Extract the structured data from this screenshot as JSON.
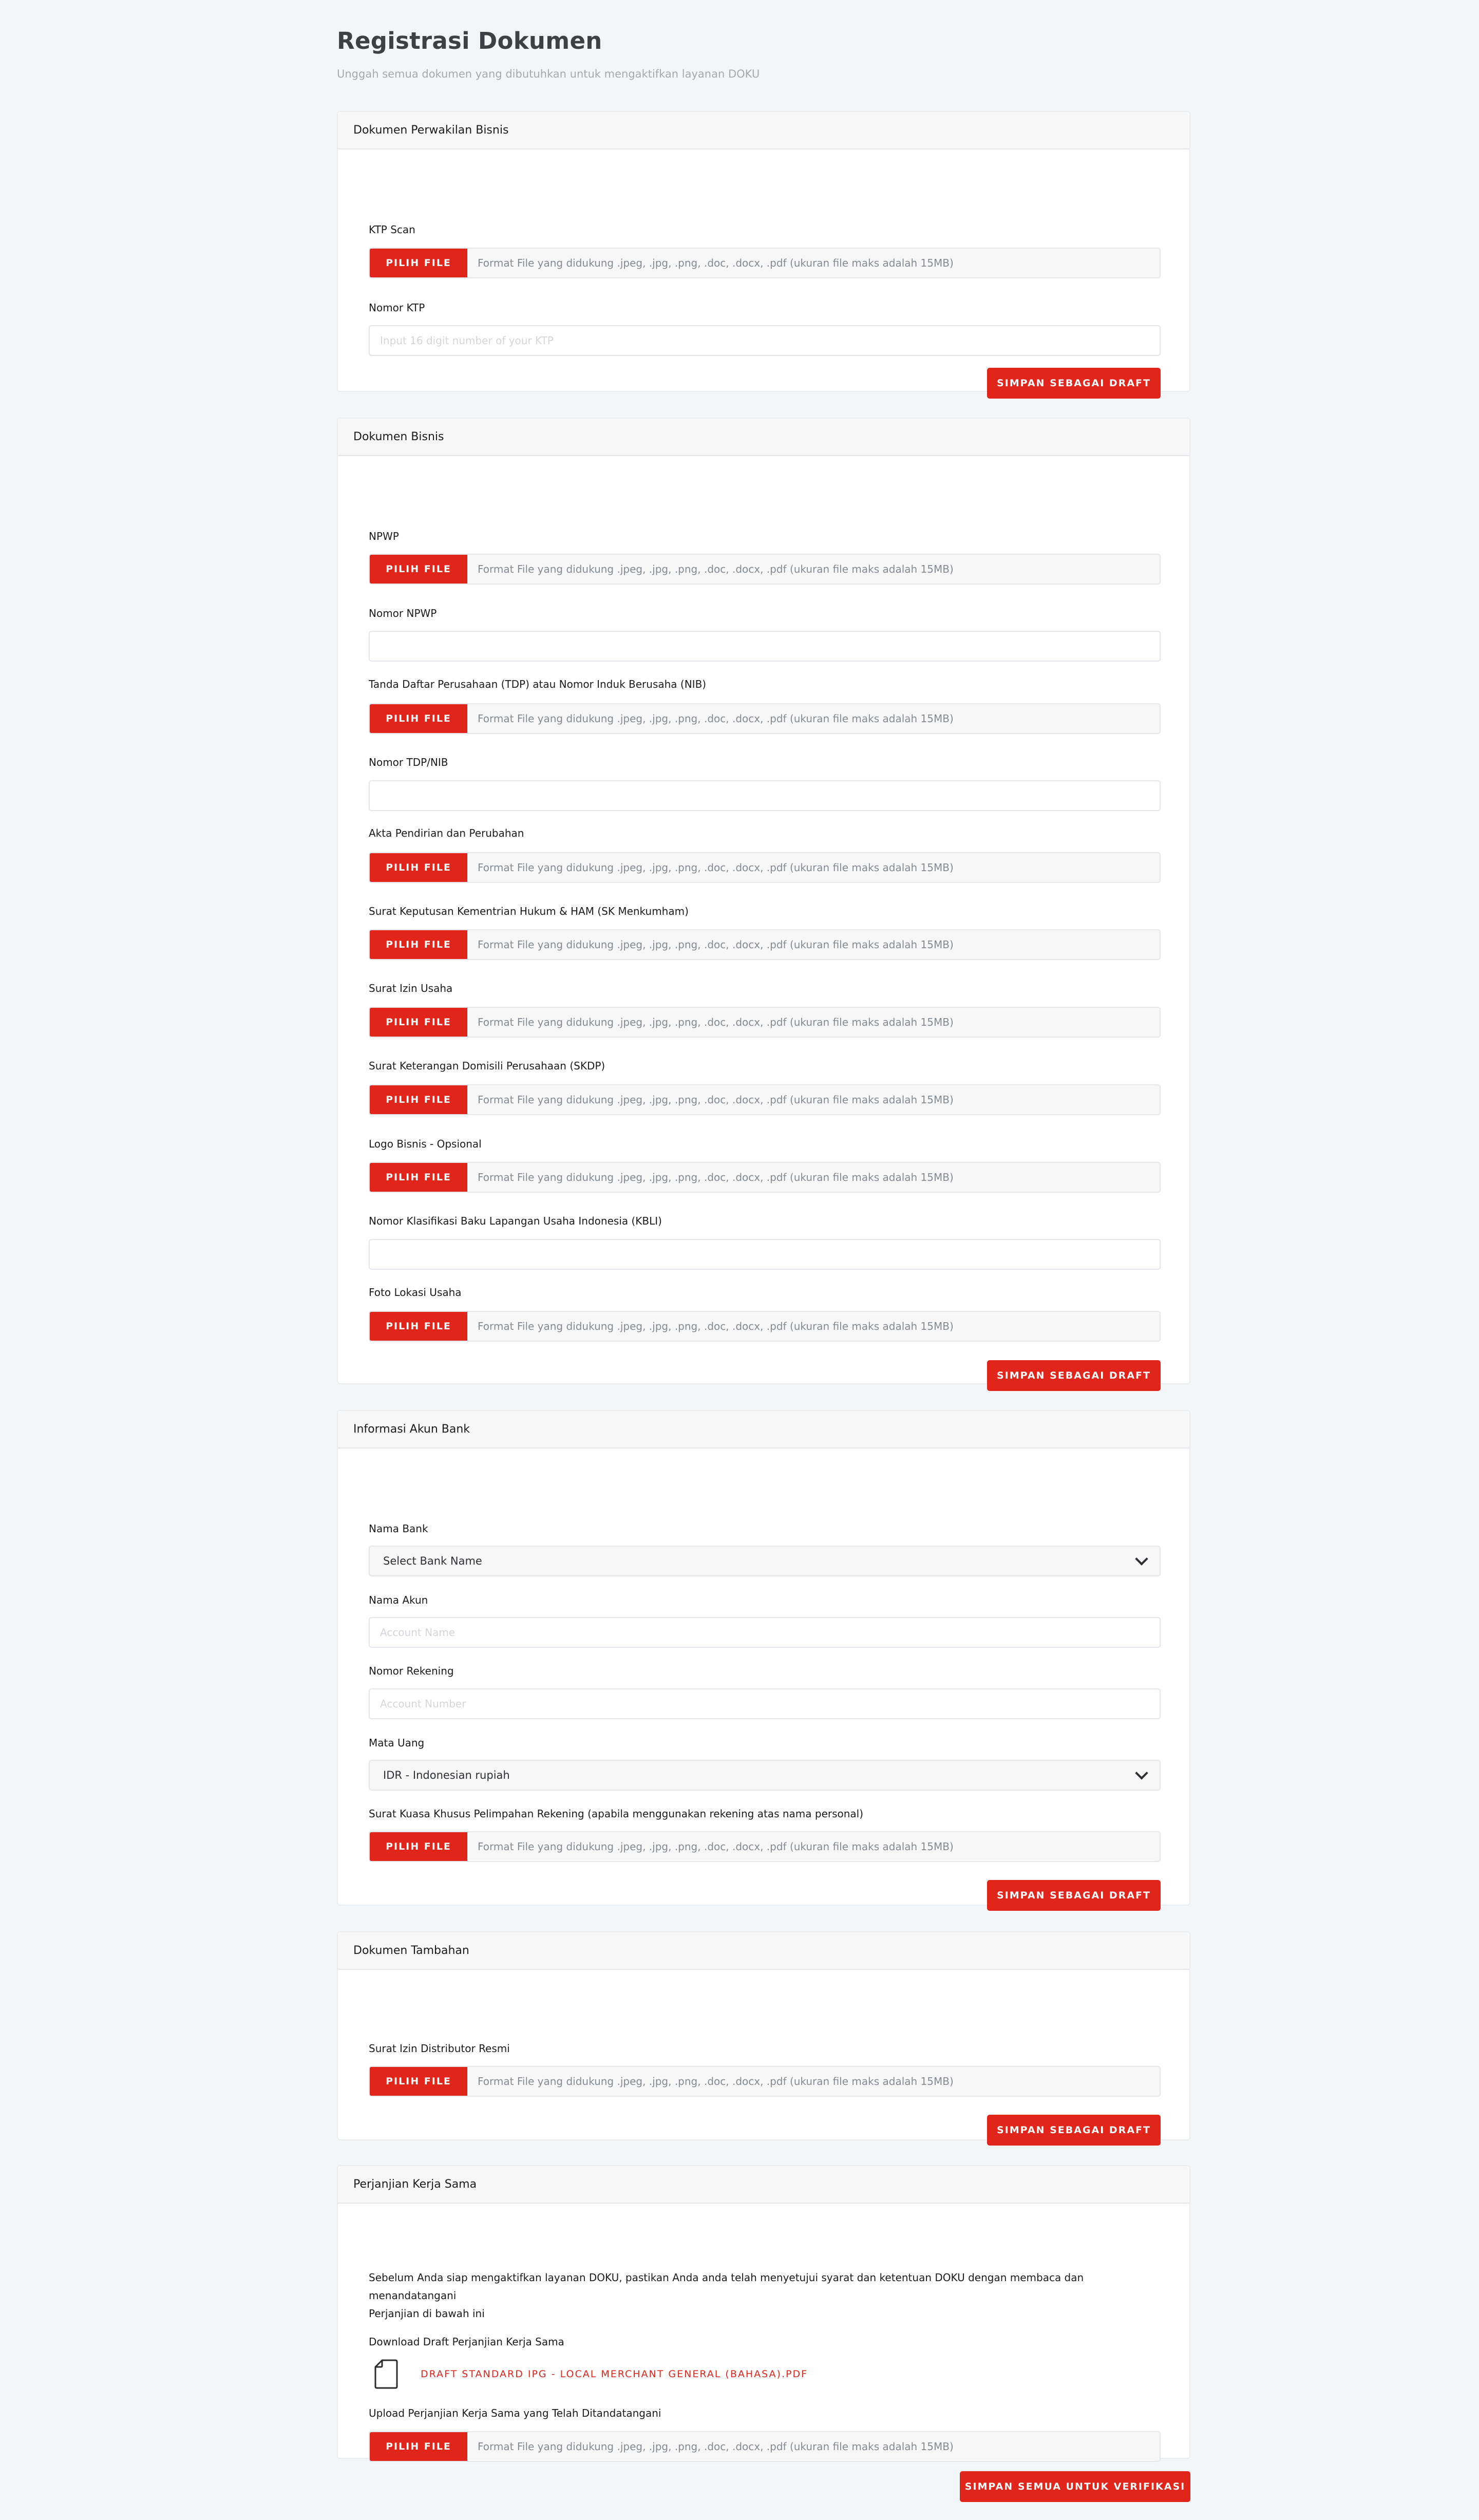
{
  "page": {
    "title": "Registrasi Dokumen",
    "subtitle": "Unggah semua dokumen yang dibutuhkan untuk mengaktifkan layanan DOKU"
  },
  "common": {
    "file_button": "PILIH FILE",
    "file_hint": "Format File yang didukung .jpeg, .jpg, .png, .doc, .docx, .pdf (ukuran file maks adalah 15MB)",
    "draft_button": "SIMPAN SEBAGAI DRAFT"
  },
  "perwakilan": {
    "header": "Dokumen Perwakilan Bisnis",
    "ktp_scan_label": "KTP Scan",
    "nomor_ktp_label": "Nomor KTP",
    "nomor_ktp_placeholder": "Input 16 digit number of your KTP"
  },
  "bisnis": {
    "header": "Dokumen Bisnis",
    "npwp_label": "NPWP",
    "nomor_npwp_label": "Nomor NPWP",
    "tdp_label": "Tanda Daftar Perusahaan (TDP) atau Nomor Induk Berusaha (NIB)",
    "nomor_tdp_label": "Nomor TDP/NIB",
    "akta_label": "Akta Pendirian dan Perubahan",
    "sk_label": "Surat Keputusan Kementrian Hukum & HAM (SK Menkumham)",
    "siu_label": "Surat Izin Usaha",
    "skdp_label": "Surat Keterangan Domisili Perusahaan (SKDP)",
    "logo_label": "Logo Bisnis - Opsional",
    "kbli_label": "Nomor Klasifikasi Baku Lapangan Usaha Indonesia (KBLI)",
    "foto_label": "Foto Lokasi Usaha"
  },
  "bank": {
    "header": "Informasi Akun Bank",
    "nama_bank_label": "Nama Bank",
    "nama_bank_value": "Select Bank Name",
    "nama_akun_label": "Nama Akun",
    "nama_akun_placeholder": "Account Name",
    "nomor_rekening_label": "Nomor Rekening",
    "nomor_rekening_placeholder": "Account Number",
    "mata_uang_label": "Mata Uang",
    "mata_uang_value": "IDR - Indonesian rupiah",
    "surat_kuasa_label": "Surat Kuasa Khusus Pelimpahan Rekening (apabila menggunakan rekening atas nama personal)"
  },
  "tambahan": {
    "header": "Dokumen Tambahan",
    "distributor_label": "Surat Izin Distributor Resmi"
  },
  "perjanjian": {
    "header": "Perjanjian Kerja Sama",
    "intro_line1": "Sebelum Anda siap mengaktifkan layanan DOKU, pastikan Anda anda telah menyetujui syarat dan ketentuan DOKU dengan membaca dan menandatangani",
    "intro_line2": "Perjanjian di bawah ini",
    "download_label": "Download Draft Perjanjian Kerja Sama",
    "download_link": "DRAFT STANDARD IPG - LOCAL MERCHANT GENERAL (BAHASA).PDF",
    "upload_label": "Upload Perjanjian Kerja Sama yang Telah Ditandatangani"
  },
  "footer": {
    "submit_all": "SIMPAN SEMUA UNTUK VERIFIKASI"
  },
  "colors": {
    "accent": "#e1251b",
    "background": "#f3f6f9"
  }
}
